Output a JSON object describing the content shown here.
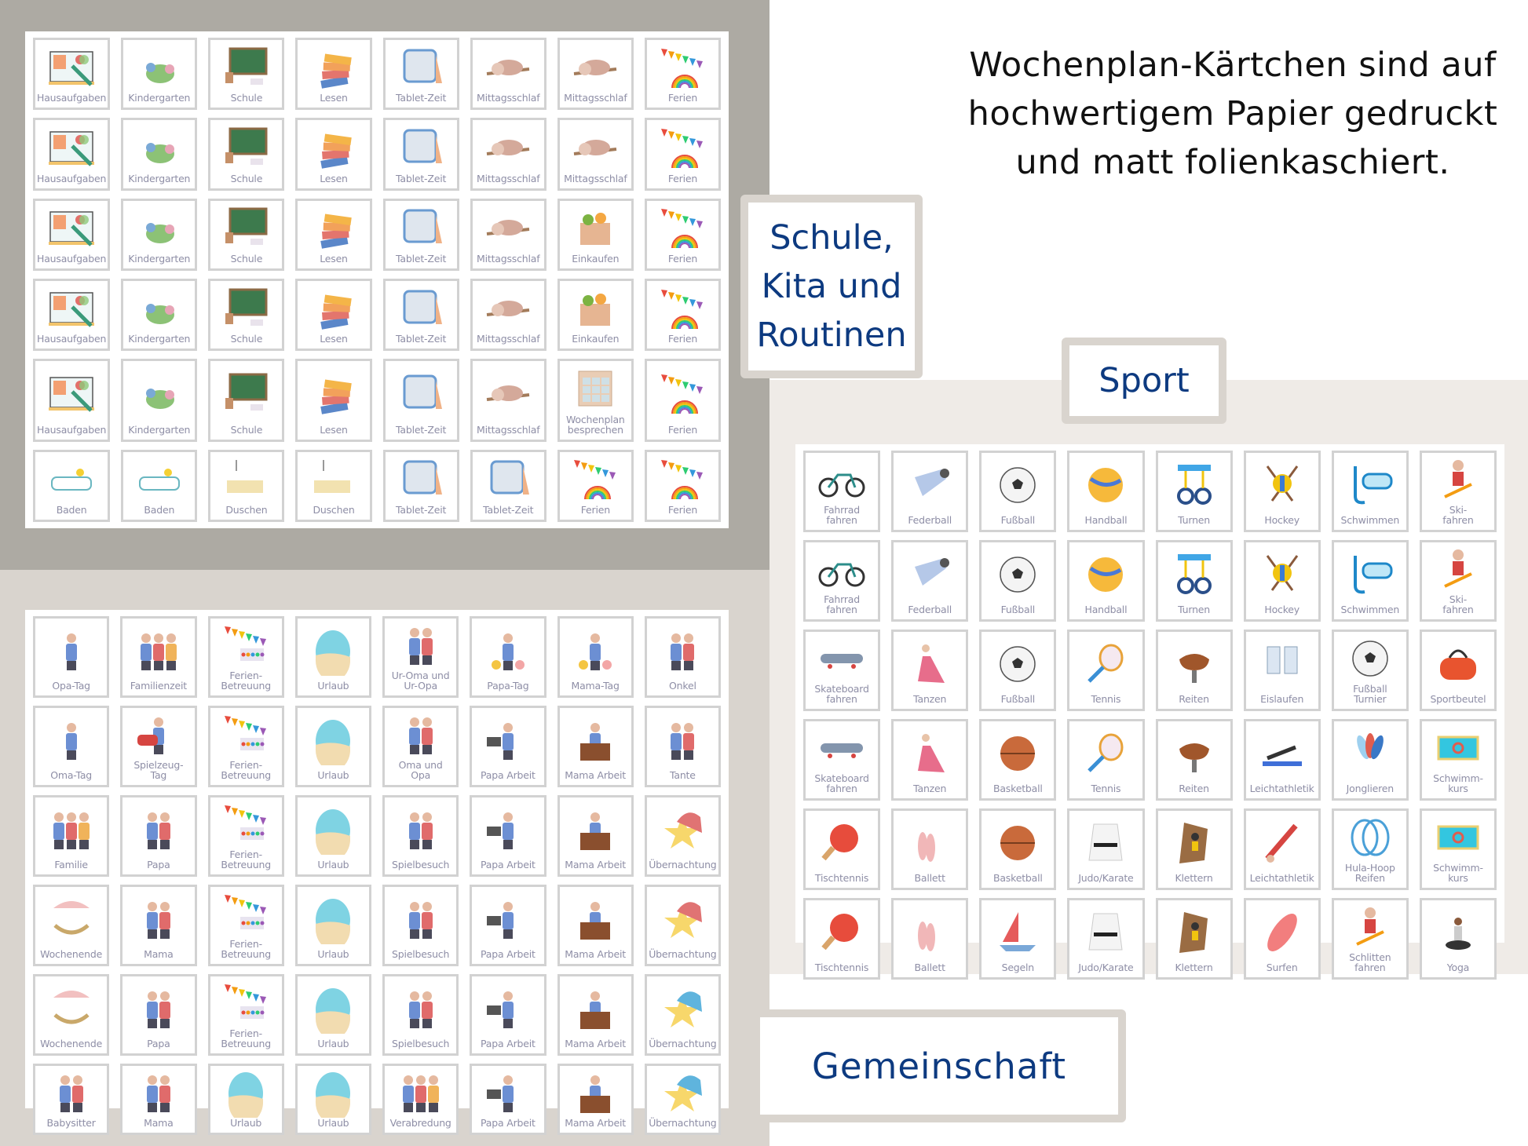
{
  "headline": "Wochenplan-Kärtchen sind auf\nhochwertigem Papier gedruckt\nund matt folienkaschiert.",
  "tags": {
    "school": "Schule,\nKita und\nRoutinen",
    "sport": "Sport",
    "community": "Gemeinschaft"
  },
  "colors": {
    "accent_text": "#0d3a80",
    "card_label": "#8e8ea6",
    "panel_school": "#adaaa3",
    "panel_community": "#d9d4ce",
    "panel_sport": "#efebe7"
  },
  "sheets": {
    "school": [
      [
        {
          "label": "Hausaufgaben",
          "icon": "homework-book-icon"
        },
        {
          "label": "Kindergarten",
          "icon": "kids-dragon-icon"
        },
        {
          "label": "Schule",
          "icon": "chalkboard-icon"
        },
        {
          "label": "Lesen",
          "icon": "books-stack-icon"
        },
        {
          "label": "Tablet-Zeit",
          "icon": "tablet-icon"
        },
        {
          "label": "Mittagsschlaf",
          "icon": "sleeping-sloth-icon"
        },
        {
          "label": "Mittagsschlaf",
          "icon": "sleeping-sloth-icon"
        },
        {
          "label": "Ferien",
          "icon": "rainbow-bunting-icon"
        }
      ],
      [
        {
          "label": "Hausaufgaben",
          "icon": "homework-book-icon"
        },
        {
          "label": "Kindergarten",
          "icon": "kids-dragon-icon"
        },
        {
          "label": "Schule",
          "icon": "chalkboard-icon"
        },
        {
          "label": "Lesen",
          "icon": "books-stack-icon"
        },
        {
          "label": "Tablet-Zeit",
          "icon": "tablet-icon"
        },
        {
          "label": "Mittagsschlaf",
          "icon": "sleeping-sloth-icon"
        },
        {
          "label": "Mittagsschlaf",
          "icon": "sleeping-sloth-icon"
        },
        {
          "label": "Ferien",
          "icon": "rainbow-bunting-icon"
        }
      ],
      [
        {
          "label": "Hausaufgaben",
          "icon": "homework-book-icon"
        },
        {
          "label": "Kindergarten",
          "icon": "kids-dragon-icon"
        },
        {
          "label": "Schule",
          "icon": "chalkboard-icon"
        },
        {
          "label": "Lesen",
          "icon": "books-stack-icon"
        },
        {
          "label": "Tablet-Zeit",
          "icon": "tablet-icon"
        },
        {
          "label": "Mittagsschlaf",
          "icon": "sleeping-sloth-icon"
        },
        {
          "label": "Einkaufen",
          "icon": "grocery-bag-icon"
        },
        {
          "label": "Ferien",
          "icon": "rainbow-bunting-icon"
        }
      ],
      [
        {
          "label": "Hausaufgaben",
          "icon": "homework-book-icon"
        },
        {
          "label": "Kindergarten",
          "icon": "kids-dragon-icon"
        },
        {
          "label": "Schule",
          "icon": "chalkboard-icon"
        },
        {
          "label": "Lesen",
          "icon": "books-stack-icon"
        },
        {
          "label": "Tablet-Zeit",
          "icon": "tablet-icon"
        },
        {
          "label": "Mittagsschlaf",
          "icon": "sleeping-sloth-icon"
        },
        {
          "label": "Einkaufen",
          "icon": "grocery-bag-icon"
        },
        {
          "label": "Ferien",
          "icon": "rainbow-bunting-icon"
        }
      ],
      [
        {
          "label": "Hausaufgaben",
          "icon": "homework-book-icon"
        },
        {
          "label": "Kindergarten",
          "icon": "kids-dragon-icon"
        },
        {
          "label": "Schule",
          "icon": "chalkboard-icon"
        },
        {
          "label": "Lesen",
          "icon": "books-stack-icon"
        },
        {
          "label": "Tablet-Zeit",
          "icon": "tablet-icon"
        },
        {
          "label": "Mittagsschlaf",
          "icon": "sleeping-sloth-icon"
        },
        {
          "label": "Wochenplan\nbesprechen",
          "icon": "calendar-icon"
        },
        {
          "label": "Ferien",
          "icon": "rainbow-bunting-icon"
        }
      ],
      [
        {
          "label": "Baden",
          "icon": "bathtub-icon"
        },
        {
          "label": "Baden",
          "icon": "bathtub-icon"
        },
        {
          "label": "Duschen",
          "icon": "shower-icon"
        },
        {
          "label": "Duschen",
          "icon": "shower-icon"
        },
        {
          "label": "Tablet-Zeit",
          "icon": "tablet-icon"
        },
        {
          "label": "Tablet-Zeit",
          "icon": "tablet-icon"
        },
        {
          "label": "Ferien",
          "icon": "rainbow-bunting-icon"
        },
        {
          "label": "Ferien",
          "icon": "rainbow-bunting-icon"
        }
      ]
    ],
    "community": [
      [
        {
          "label": "Opa-Tag",
          "icon": "grandpa-icon"
        },
        {
          "label": "Familienzeit",
          "icon": "family-picnic-icon"
        },
        {
          "label": "Ferien-\nBetreuung",
          "icon": "bunting-paints-icon"
        },
        {
          "label": "Urlaub",
          "icon": "beach-icon"
        },
        {
          "label": "Ur-Oma und\nUr-Opa",
          "icon": "great-grandparents-icon"
        },
        {
          "label": "Papa-Tag",
          "icon": "father-child-flowers-icon"
        },
        {
          "label": "Mama-Tag",
          "icon": "mother-child-flowers-icon"
        },
        {
          "label": "Onkel",
          "icon": "uncle-icon"
        }
      ],
      [
        {
          "label": "Oma-Tag",
          "icon": "grandma-icon"
        },
        {
          "label": "Spielzeug-\nTag",
          "icon": "toys-icon"
        },
        {
          "label": "Ferien-\nBetreuung",
          "icon": "bunting-paints-icon"
        },
        {
          "label": "Urlaub",
          "icon": "beach-icon"
        },
        {
          "label": "Oma und\nOpa",
          "icon": "grandparents-icon"
        },
        {
          "label": "Papa Arbeit",
          "icon": "father-laptop-icon"
        },
        {
          "label": "Mama Arbeit",
          "icon": "mother-desk-icon"
        },
        {
          "label": "Tante",
          "icon": "aunt-icon"
        }
      ],
      [
        {
          "label": "Familie",
          "icon": "family-group-icon"
        },
        {
          "label": "Papa",
          "icon": "father-shoulders-icon"
        },
        {
          "label": "Ferien-\nBetreuung",
          "icon": "bunting-paints-icon"
        },
        {
          "label": "Urlaub",
          "icon": "beach-icon"
        },
        {
          "label": "Spielbesuch",
          "icon": "playdate-icon"
        },
        {
          "label": "Papa Arbeit",
          "icon": "father-laptop-icon"
        },
        {
          "label": "Mama Arbeit",
          "icon": "mother-desk-icon"
        },
        {
          "label": "Übernachtung",
          "icon": "sleepy-star-red-icon"
        }
      ],
      [
        {
          "label": "Wochenende",
          "icon": "hammock-icon"
        },
        {
          "label": "Mama",
          "icon": "mother-hug-icon"
        },
        {
          "label": "Ferien-\nBetreuung",
          "icon": "bunting-paints-icon"
        },
        {
          "label": "Urlaub",
          "icon": "beach-icon"
        },
        {
          "label": "Spielbesuch",
          "icon": "playdate-guitar-icon"
        },
        {
          "label": "Papa Arbeit",
          "icon": "father-laptop-icon"
        },
        {
          "label": "Mama Arbeit",
          "icon": "mother-desk-icon"
        },
        {
          "label": "Übernachtung",
          "icon": "sleepy-star-red-icon"
        }
      ],
      [
        {
          "label": "Wochenende",
          "icon": "hammock-icon"
        },
        {
          "label": "Papa",
          "icon": "father-shoulders-icon"
        },
        {
          "label": "Ferien-\nBetreuung",
          "icon": "bunting-paints-icon"
        },
        {
          "label": "Urlaub",
          "icon": "beach-icon"
        },
        {
          "label": "Spielbesuch",
          "icon": "playdate-flower-icon"
        },
        {
          "label": "Papa Arbeit",
          "icon": "father-laptop-icon"
        },
        {
          "label": "Mama Arbeit",
          "icon": "mother-desk-icon"
        },
        {
          "label": "Übernachtung",
          "icon": "sleepy-star-blue-icon"
        }
      ],
      [
        {
          "label": "Babysitter",
          "icon": "babysitter-icon"
        },
        {
          "label": "Mama",
          "icon": "mother-hug-icon"
        },
        {
          "label": "Urlaub",
          "icon": "beach-icon"
        },
        {
          "label": "Urlaub",
          "icon": "beach-icon"
        },
        {
          "label": "Verabredung",
          "icon": "kids-playing-icon"
        },
        {
          "label": "Papa Arbeit",
          "icon": "father-laptop-icon"
        },
        {
          "label": "Mama Arbeit",
          "icon": "mother-desk-icon"
        },
        {
          "label": "Übernachtung",
          "icon": "sleepy-star-blue-icon"
        }
      ]
    ],
    "sport": [
      [
        {
          "label": "Fahrrad\nfahren",
          "icon": "bicycle-icon"
        },
        {
          "label": "Federball",
          "icon": "shuttlecock-icon"
        },
        {
          "label": "Fußball",
          "icon": "soccer-ball-icon"
        },
        {
          "label": "Handball",
          "icon": "volleyball-icon"
        },
        {
          "label": "Turnen",
          "icon": "gym-rings-icon"
        },
        {
          "label": "Hockey",
          "icon": "hockey-sticks-icon"
        },
        {
          "label": "Schwimmen",
          "icon": "snorkel-mask-icon"
        },
        {
          "label": "Ski-\nfahren",
          "icon": "skier-icon"
        }
      ],
      [
        {
          "label": "Fahrrad\nfahren",
          "icon": "bicycle-icon"
        },
        {
          "label": "Federball",
          "icon": "shuttlecock-icon"
        },
        {
          "label": "Fußball",
          "icon": "soccer-ball-icon"
        },
        {
          "label": "Handball",
          "icon": "volleyball-icon"
        },
        {
          "label": "Turnen",
          "icon": "gym-rings-icon"
        },
        {
          "label": "Hockey",
          "icon": "hockey-sticks-icon"
        },
        {
          "label": "Schwimmen",
          "icon": "snorkel-mask-icon"
        },
        {
          "label": "Ski-\nfahren",
          "icon": "skier-icon"
        }
      ],
      [
        {
          "label": "Skateboard\nfahren",
          "icon": "skateboard-icon"
        },
        {
          "label": "Tanzen",
          "icon": "dancer-icon"
        },
        {
          "label": "Fußball",
          "icon": "soccer-ball-icon"
        },
        {
          "label": "Tennis",
          "icon": "tennis-racket-icon"
        },
        {
          "label": "Reiten",
          "icon": "saddle-icon"
        },
        {
          "label": "Eislaufen",
          "icon": "ice-skates-icon"
        },
        {
          "label": "Fußball\nTurnier",
          "icon": "kids-soccer-icon"
        },
        {
          "label": "Sportbeutel",
          "icon": "sports-bag-icon"
        }
      ],
      [
        {
          "label": "Skateboard\nfahren",
          "icon": "skateboard-icon"
        },
        {
          "label": "Tanzen",
          "icon": "dancer-icon"
        },
        {
          "label": "Basketball",
          "icon": "basketball-icon"
        },
        {
          "label": "Tennis",
          "icon": "tennis-racket-icon"
        },
        {
          "label": "Reiten",
          "icon": "saddle-icon"
        },
        {
          "label": "Leichtathletik",
          "icon": "plank-exercise-icon"
        },
        {
          "label": "Jonglieren",
          "icon": "juggling-clubs-icon"
        },
        {
          "label": "Schwimm-\nkurs",
          "icon": "swimming-pool-icon"
        }
      ],
      [
        {
          "label": "Tischtennis",
          "icon": "ping-pong-paddle-icon"
        },
        {
          "label": "Ballett",
          "icon": "ballet-shoes-icon"
        },
        {
          "label": "Basketball",
          "icon": "basketball-icon"
        },
        {
          "label": "Judo/Karate",
          "icon": "karate-gi-icon"
        },
        {
          "label": "Klettern",
          "icon": "climber-icon"
        },
        {
          "label": "Leichtathletik",
          "icon": "high-jump-icon"
        },
        {
          "label": "Hula-Hoop\nReifen",
          "icon": "hula-hoop-icon"
        },
        {
          "label": "Schwimm-\nkurs",
          "icon": "swimming-pool-icon"
        }
      ],
      [
        {
          "label": "Tischtennis",
          "icon": "ping-pong-paddle-icon"
        },
        {
          "label": "Ballett",
          "icon": "ballet-shoes-icon"
        },
        {
          "label": "Segeln",
          "icon": "sailboat-icon"
        },
        {
          "label": "Judo/Karate",
          "icon": "karate-gi-icon"
        },
        {
          "label": "Klettern",
          "icon": "climber-icon"
        },
        {
          "label": "Surfen",
          "icon": "surfboard-icon"
        },
        {
          "label": "Schlitten\nfahren",
          "icon": "sledding-icon"
        },
        {
          "label": "Yoga",
          "icon": "yoga-icon"
        }
      ]
    ]
  }
}
